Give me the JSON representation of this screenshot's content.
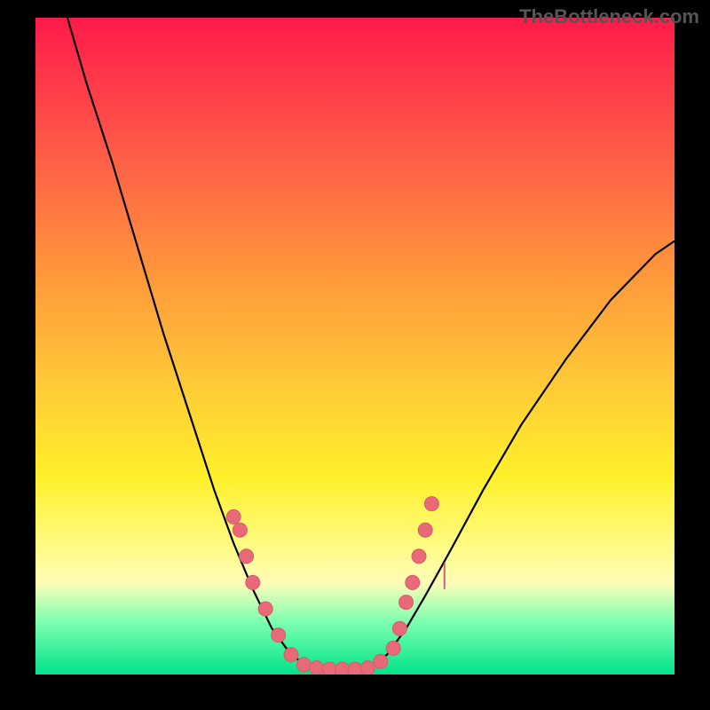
{
  "watermark": "TheBottleneck.com",
  "colors": {
    "gradient_top": "#ff1a4a",
    "gradient_mid": "#ffd83a",
    "gradient_bottom": "#00e38a",
    "curve": "#000000",
    "marker": "#e86a78",
    "background": "#000000"
  },
  "chart_data": {
    "type": "line",
    "title": "",
    "xlabel": "",
    "ylabel": "",
    "xlim": [
      0,
      100
    ],
    "ylim": [
      0,
      100
    ],
    "curve": [
      {
        "x": 5,
        "y": 100
      },
      {
        "x": 8,
        "y": 90
      },
      {
        "x": 12,
        "y": 78
      },
      {
        "x": 16,
        "y": 65
      },
      {
        "x": 20,
        "y": 52
      },
      {
        "x": 24,
        "y": 40
      },
      {
        "x": 28,
        "y": 28
      },
      {
        "x": 31,
        "y": 20
      },
      {
        "x": 34,
        "y": 13
      },
      {
        "x": 37,
        "y": 7
      },
      {
        "x": 40,
        "y": 3
      },
      {
        "x": 43,
        "y": 1
      },
      {
        "x": 46,
        "y": 0.5
      },
      {
        "x": 49,
        "y": 0.5
      },
      {
        "x": 52,
        "y": 1
      },
      {
        "x": 55,
        "y": 3
      },
      {
        "x": 58,
        "y": 7
      },
      {
        "x": 61,
        "y": 12
      },
      {
        "x": 65,
        "y": 19
      },
      {
        "x": 70,
        "y": 28
      },
      {
        "x": 76,
        "y": 38
      },
      {
        "x": 83,
        "y": 48
      },
      {
        "x": 90,
        "y": 57
      },
      {
        "x": 97,
        "y": 64
      },
      {
        "x": 100,
        "y": 66
      }
    ],
    "markers": [
      {
        "x": 31,
        "y": 24
      },
      {
        "x": 32,
        "y": 22
      },
      {
        "x": 33,
        "y": 18
      },
      {
        "x": 34,
        "y": 14
      },
      {
        "x": 36,
        "y": 10
      },
      {
        "x": 38,
        "y": 6
      },
      {
        "x": 40,
        "y": 3
      },
      {
        "x": 42,
        "y": 1.5
      },
      {
        "x": 44,
        "y": 1
      },
      {
        "x": 46,
        "y": 0.8
      },
      {
        "x": 48,
        "y": 0.8
      },
      {
        "x": 50,
        "y": 0.8
      },
      {
        "x": 52,
        "y": 1
      },
      {
        "x": 54,
        "y": 2
      },
      {
        "x": 56,
        "y": 4
      },
      {
        "x": 57,
        "y": 7
      },
      {
        "x": 58,
        "y": 11
      },
      {
        "x": 59,
        "y": 14
      },
      {
        "x": 60,
        "y": 18
      },
      {
        "x": 61,
        "y": 22
      },
      {
        "x": 62,
        "y": 26
      }
    ],
    "tiny_bar": {
      "x": 64,
      "y0": 13,
      "y1": 17
    }
  }
}
